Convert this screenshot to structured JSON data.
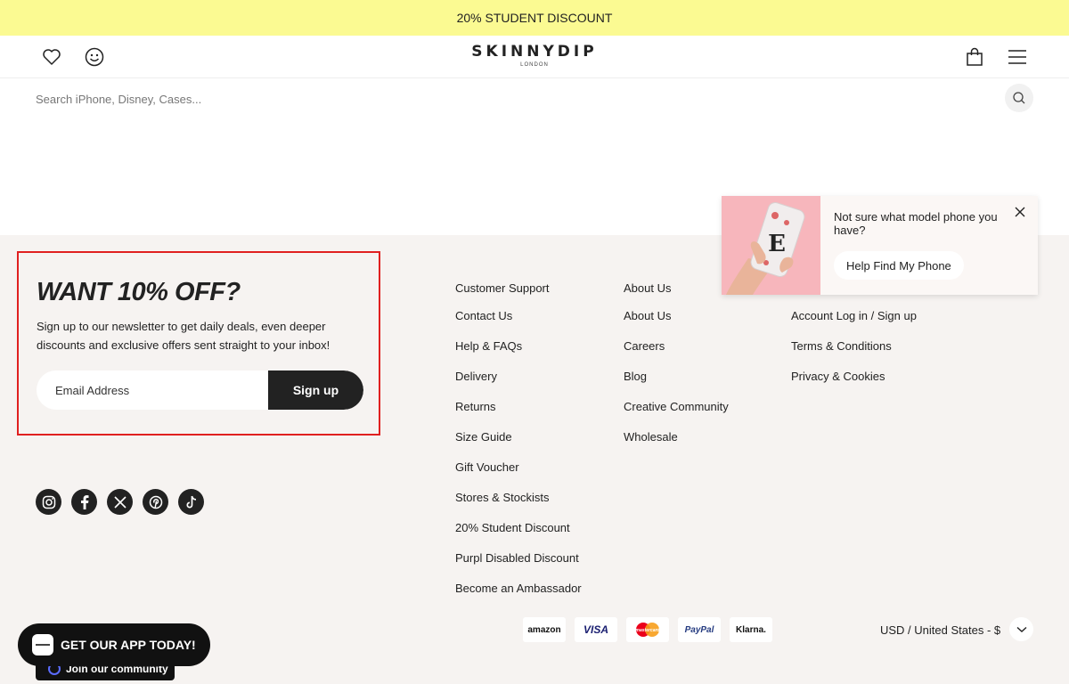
{
  "promo": {
    "text": "20% STUDENT DISCOUNT"
  },
  "header": {
    "logo": "SKINNYDIP",
    "logo_sub": "LONDON",
    "icons": [
      "heart-icon",
      "smiley-icon",
      "bag-icon",
      "menu-icon"
    ]
  },
  "search": {
    "placeholder": "Search iPhone, Disney, Cases..."
  },
  "newsletter": {
    "title": "WANT 10% OFF?",
    "text": "Sign up to our newsletter to get daily deals, even deeper discounts and exclusive offers sent straight to your inbox!",
    "email_placeholder": "Email Address",
    "button": "Sign up",
    "highlight_color": "#e02020"
  },
  "social": [
    "instagram-icon",
    "facebook-icon",
    "x-icon",
    "pinterest-icon",
    "tiktok-icon"
  ],
  "columns": {
    "support": {
      "title": "Customer Support",
      "links": [
        "Contact Us",
        "Help & FAQs",
        "Delivery",
        "Returns",
        "Size Guide",
        "Gift Voucher",
        "Stores & Stockists",
        "20% Student Discount",
        "Purpl Disabled Discount",
        "Become an Ambassador"
      ]
    },
    "about": {
      "title": "About Us",
      "links": [
        "About Us",
        "Careers",
        "Blog",
        "Creative Community",
        "Wholesale"
      ]
    },
    "account": {
      "links": [
        "Account Log in / Sign up",
        "Terms & Conditions",
        "Privacy & Cookies"
      ]
    }
  },
  "payments": [
    "amazon",
    "VISA",
    "mastercard",
    "PayPal",
    "Klarna."
  ],
  "currency": {
    "label": "USD / United States - $"
  },
  "popup": {
    "text": "Not sure what model phone you have?",
    "button": "Help Find My Phone"
  },
  "app_banner": {
    "label": "GET OUR APP TODAY!"
  },
  "community": {
    "label": "Join our community"
  },
  "colors": {
    "promo_bg": "#fbfa92",
    "footer_bg": "#f6f3f1",
    "dark": "#222222"
  }
}
